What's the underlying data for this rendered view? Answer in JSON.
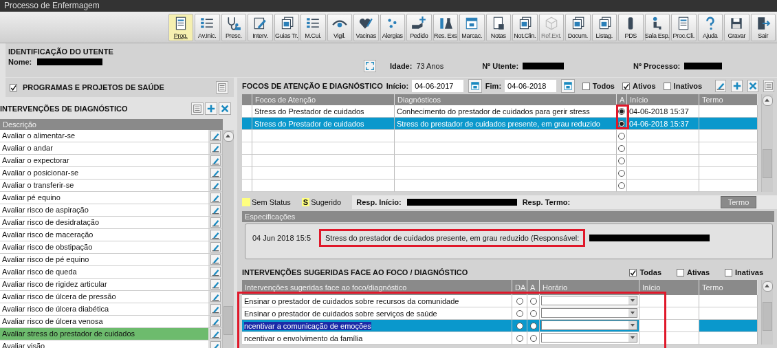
{
  "window": {
    "title": "Processo de Enfermagem"
  },
  "toolbar": [
    {
      "label": "Prog.",
      "selected": true,
      "disabled": false
    },
    {
      "label": "Av.Inic.",
      "selected": false,
      "disabled": false
    },
    {
      "label": "Presc.",
      "selected": false,
      "disabled": false
    },
    {
      "label": "Interv.",
      "selected": false,
      "disabled": false
    },
    {
      "label": "Guias Tr.",
      "selected": false,
      "disabled": false
    },
    {
      "label": "M.Cui.",
      "selected": false,
      "disabled": false
    },
    {
      "label": "Vigil.",
      "selected": false,
      "disabled": false
    },
    {
      "label": "Vacinas",
      "selected": false,
      "disabled": false
    },
    {
      "label": "Alergias",
      "selected": false,
      "disabled": false
    },
    {
      "label": "Pedido",
      "selected": false,
      "disabled": false
    },
    {
      "label": "Res. Exs",
      "selected": false,
      "disabled": false
    },
    {
      "label": "Marcac.",
      "selected": false,
      "disabled": false
    },
    {
      "label": "Notas",
      "selected": false,
      "disabled": false
    },
    {
      "label": "Not.Clin.",
      "selected": false,
      "disabled": false
    },
    {
      "label": "Ref.Ext.",
      "selected": false,
      "disabled": true
    },
    {
      "label": "Docum.",
      "selected": false,
      "disabled": false
    },
    {
      "label": "Listag.",
      "selected": false,
      "disabled": false
    },
    {
      "label": "PDS",
      "selected": false,
      "disabled": false
    },
    {
      "label": "Sala Esp.",
      "selected": false,
      "disabled": false
    },
    {
      "label": "Proc.Cli.",
      "selected": false,
      "disabled": false
    },
    {
      "label": "Ajuda",
      "selected": false,
      "disabled": false
    },
    {
      "label": "Gravar",
      "selected": false,
      "disabled": false
    },
    {
      "label": "Sair",
      "selected": false,
      "disabled": false
    }
  ],
  "patient": {
    "title": "IDENTIFICAÇÃO DO UTENTE",
    "name_label": "Nome:",
    "age_label": "Idade:",
    "age": "73 Anos",
    "number_label": "Nº Utente:",
    "process_label": "Nº Processo:"
  },
  "programs": {
    "title": "PROGRAMAS E PROJETOS DE SAÚDE",
    "checked": true
  },
  "interventions": {
    "title": "INTERVENÇÕES DE DIAGNÓSTICO",
    "column": "Descrição",
    "items": [
      {
        "label": "Avaliar o alimentar-se",
        "selected": false
      },
      {
        "label": "Avaliar o andar",
        "selected": false
      },
      {
        "label": "Avaliar o expectorar",
        "selected": false
      },
      {
        "label": "Avaliar o posicionar-se",
        "selected": false
      },
      {
        "label": "Avaliar o transferir-se",
        "selected": false
      },
      {
        "label": "Avaliar pé equino",
        "selected": false
      },
      {
        "label": "Avaliar risco de aspiração",
        "selected": false
      },
      {
        "label": "Avaliar risco de desidratação",
        "selected": false
      },
      {
        "label": "Avaliar risco de maceração",
        "selected": false
      },
      {
        "label": "Avaliar risco de obstipação",
        "selected": false
      },
      {
        "label": "Avaliar risco de pé equino",
        "selected": false
      },
      {
        "label": "Avaliar risco de queda",
        "selected": false
      },
      {
        "label": "Avaliar risco de rigidez articular",
        "selected": false
      },
      {
        "label": "Avaliar risco de úlcera de pressão",
        "selected": false
      },
      {
        "label": "Avaliar risco de úlcera diabética",
        "selected": false
      },
      {
        "label": "Avaliar risco de úlcera venosa",
        "selected": false
      },
      {
        "label": "Avaliar stress do prestador de cuidados",
        "selected": true
      },
      {
        "label": "Avaliar visão",
        "selected": false
      }
    ]
  },
  "foci": {
    "title": "FOCOS DE ATENÇÃO E DIAGNÓSTICO",
    "start_label": "Início:",
    "start": "04-06-2017",
    "end_label": "Fim:",
    "end": "04-06-2018",
    "filters": [
      {
        "label": "Todos",
        "checked": false
      },
      {
        "label": "Ativos",
        "checked": true
      },
      {
        "label": "Inativos",
        "checked": false
      }
    ],
    "columns": [
      "Focos de Atenção",
      "Diagnósticos",
      "A",
      "Início",
      "Termo"
    ],
    "rows": [
      {
        "focus": "Stress do Prestador de cuidados",
        "diagnosis": "Conhecimento do prestador de cuidados para gerir stress",
        "start": "04-06-2018 15:37",
        "active": true,
        "selected": false
      },
      {
        "focus": "Stress do Prestador de cuidados",
        "diagnosis": "Stress do prestador de cuidados presente, em grau reduzido",
        "start": "04-06-2018 15:37",
        "active": true,
        "selected": true
      },
      {
        "active": false,
        "selected": false
      },
      {
        "active": false,
        "selected": false
      },
      {
        "active": false,
        "selected": false
      },
      {
        "active": false,
        "selected": false
      },
      {
        "active": false,
        "selected": false
      }
    ]
  },
  "legend": [
    {
      "kind": "swatch",
      "label": "Sem Status"
    },
    {
      "kind": "letter",
      "mark": "S",
      "label": "Sugerido"
    }
  ],
  "responsible": {
    "start_label": "Resp. Início:",
    "end_label": "Resp. Termo:",
    "button": "Termo"
  },
  "specs": {
    "title": "Especificações",
    "time": "04 Jun 2018 15:5",
    "text": "Stress do prestador de cuidados presente, em grau reduzido  (Responsável:"
  },
  "suggested": {
    "title": "INTERVENÇÕES SUGERIDAS FACE AO FOCO / DIAGNÓSTICO",
    "filters": [
      {
        "label": "Todas",
        "checked": true
      },
      {
        "label": "Ativas",
        "checked": false
      },
      {
        "label": "Inativas",
        "checked": false
      }
    ],
    "columns": [
      "Intervenções sugeridas face ao foco/diagnóstico",
      "DA",
      "A",
      "Horário",
      "Início",
      "Termo"
    ],
    "rows": [
      {
        "label": "Ensinar o prestador de cuidados sobre recursos da comunidade",
        "selected": false,
        "da": false,
        "a": false
      },
      {
        "label": "Ensinar o prestador de cuidados sobre serviços de saúde",
        "selected": false,
        "da": false,
        "a": false
      },
      {
        "label": "ncentivar a comunicação de emoções",
        "selected": true,
        "da": false,
        "a": false
      },
      {
        "label": "ncentivar o envolvimento da família",
        "selected": false,
        "da": false,
        "a": false
      }
    ]
  }
}
